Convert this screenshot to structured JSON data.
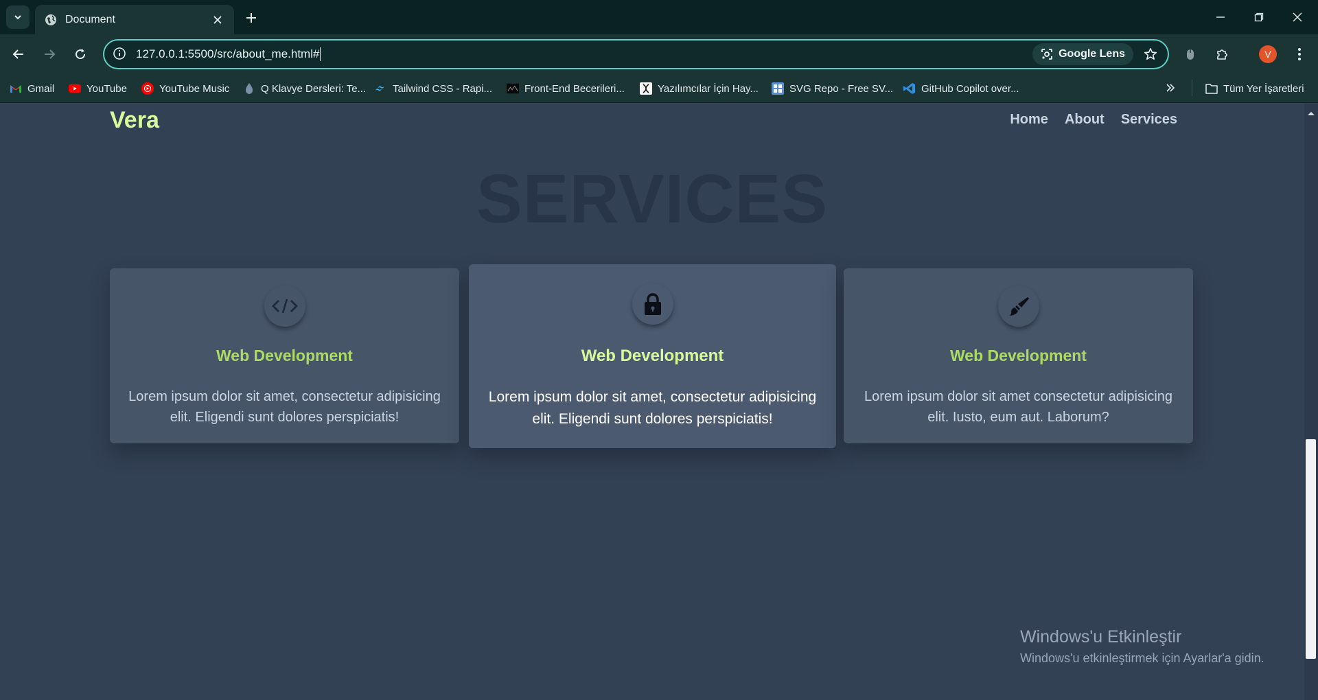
{
  "browser": {
    "tab_title": "Document",
    "url": "127.0.0.1:5500/src/about_me.html#",
    "lens_label": "Google Lens",
    "profile_initial": "V",
    "bookmarks": [
      {
        "label": "Gmail",
        "icon": "gmail-icon"
      },
      {
        "label": "YouTube",
        "icon": "youtube-icon"
      },
      {
        "label": "YouTube Music",
        "icon": "youtube-music-icon"
      },
      {
        "label": "Q Klavye Dersleri: Te...",
        "icon": "drop-icon"
      },
      {
        "label": "Tailwind CSS - Rapi...",
        "icon": "tailwind-icon"
      },
      {
        "label": "Front-End Becerileri...",
        "icon": "frontend-icon"
      },
      {
        "label": "Yazılımcılar İçin Hay...",
        "icon": "dna-icon"
      },
      {
        "label": "SVG Repo - Free SV...",
        "icon": "svgrepo-icon"
      },
      {
        "label": "GitHub Copilot over...",
        "icon": "vscode-icon"
      }
    ],
    "all_bookmarks_label": "Tüm Yer İşaretleri"
  },
  "page": {
    "logo": "Vera",
    "nav": [
      "Home",
      "About",
      "Services"
    ],
    "section_title": "SERVICES",
    "cards": [
      {
        "icon": "code-icon",
        "title": "Web Development",
        "text": "Lorem ipsum dolor sit amet, consectetur adipisicing elit. Eligendi sunt dolores perspiciatis!"
      },
      {
        "icon": "lock-icon",
        "title": "Web Development",
        "text": "Lorem ipsum dolor sit amet, consectetur adipisicing elit. Eligendi sunt dolores perspiciatis!"
      },
      {
        "icon": "brush-icon",
        "title": "Web Development",
        "text": "Lorem ipsum dolor sit amet consectetur adipisicing elit. Iusto, eum aut. Laborum?"
      }
    ]
  },
  "watermark": {
    "line1": "Windows'u Etkinleştir",
    "line2": "Windows'u etkinleştirmek için Ayarlar'a gidin."
  },
  "colors": {
    "accent": "#d9f99d",
    "page_bg": "#334155",
    "card_bg": "#475569",
    "chrome_bg": "#1b3434",
    "omnibox_border": "#5fd0c8"
  }
}
